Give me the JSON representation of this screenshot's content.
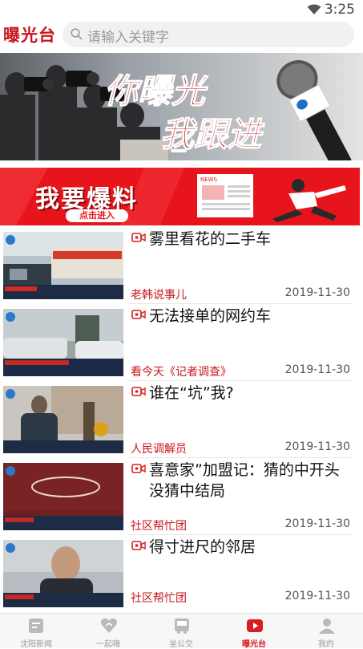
{
  "status_bar": {
    "time": "3:25"
  },
  "header": {
    "logo": "曝光台",
    "search_placeholder": "请输入关键字"
  },
  "banner": {
    "line1": "你曝光",
    "line2": "我跟进"
  },
  "promo": {
    "title": "我要爆料",
    "button": "点击进入",
    "paper_label": "NEWS"
  },
  "news": [
    {
      "title": "雾里看花的二手车",
      "source": "老韩说事儿",
      "date": "2019-11-30",
      "thumb_caption": "雾里看花"
    },
    {
      "title": "无法接单的网约车",
      "source": "看今天《记者调查》",
      "date": "2019-11-30",
      "thumb_caption": "记者调查：无法接单的网约车"
    },
    {
      "title": "谁在“坑”我?",
      "source": "人民调解员",
      "date": "2019-11-30",
      "thumb_caption": ""
    },
    {
      "title": "喜意家”加盟记：猜的中开头 没猜中结局",
      "source": "社区帮忙团",
      "date": "2019-11-30",
      "thumb_caption": "喜意家"
    },
    {
      "title": "得寸进尺的邻居",
      "source": "社区帮忙团",
      "date": "2019-11-30",
      "thumb_caption": ""
    }
  ],
  "tabs": [
    {
      "label": "沈阳新闻",
      "icon": "news-icon",
      "active": false
    },
    {
      "label": "一起嗨",
      "icon": "heart-icon",
      "active": false
    },
    {
      "label": "坐公交",
      "icon": "bus-icon",
      "active": false
    },
    {
      "label": "曝光台",
      "icon": "play-icon",
      "active": true
    },
    {
      "label": "我的",
      "icon": "user-icon",
      "active": false
    }
  ],
  "colors": {
    "brand_red": "#c8161d",
    "tab_active": "#d81e23"
  }
}
